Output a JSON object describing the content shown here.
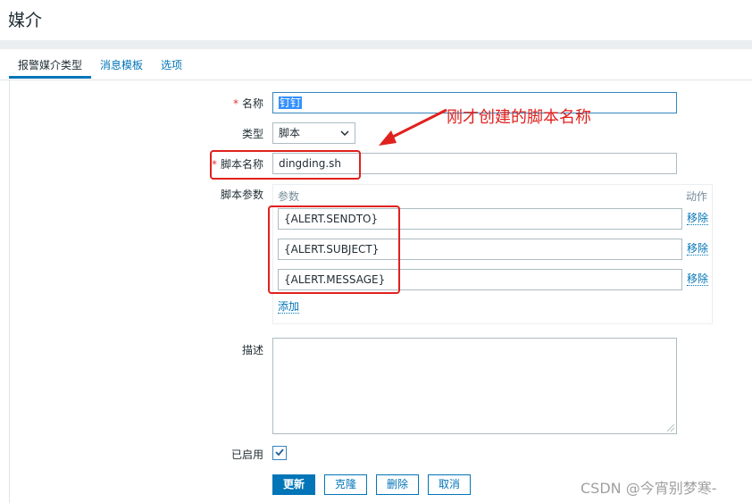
{
  "page": {
    "title": "媒介"
  },
  "tabs": [
    {
      "label": "报警媒介类型",
      "active": true
    },
    {
      "label": "消息模板",
      "active": false
    },
    {
      "label": "选项",
      "active": false
    }
  ],
  "form": {
    "name": {
      "label": "名称",
      "value": "钉钉",
      "required": true
    },
    "type": {
      "label": "类型",
      "value": "脚本"
    },
    "script_name": {
      "label": "脚本名称",
      "value": "dingding.sh",
      "required": true
    },
    "script_params": {
      "label": "脚本参数",
      "col_param": "参数",
      "col_action": "动作",
      "rows": [
        {
          "value": "{ALERT.SENDTO}",
          "action": "移除"
        },
        {
          "value": "{ALERT.SUBJECT}",
          "action": "移除"
        },
        {
          "value": "{ALERT.MESSAGE}",
          "action": "移除"
        }
      ],
      "add_label": "添加"
    },
    "description": {
      "label": "描述",
      "value": ""
    },
    "enabled": {
      "label": "已启用",
      "checked": true
    }
  },
  "buttons": {
    "update": "更新",
    "clone": "克隆",
    "delete": "删除",
    "cancel": "取消"
  },
  "annotation": {
    "text": "刚才创建的脚本名称",
    "color": "#e0211d"
  },
  "watermark": "CSDN @今宵别梦寒-",
  "colors": {
    "accent": "#0275b8",
    "required": "#e33734"
  }
}
